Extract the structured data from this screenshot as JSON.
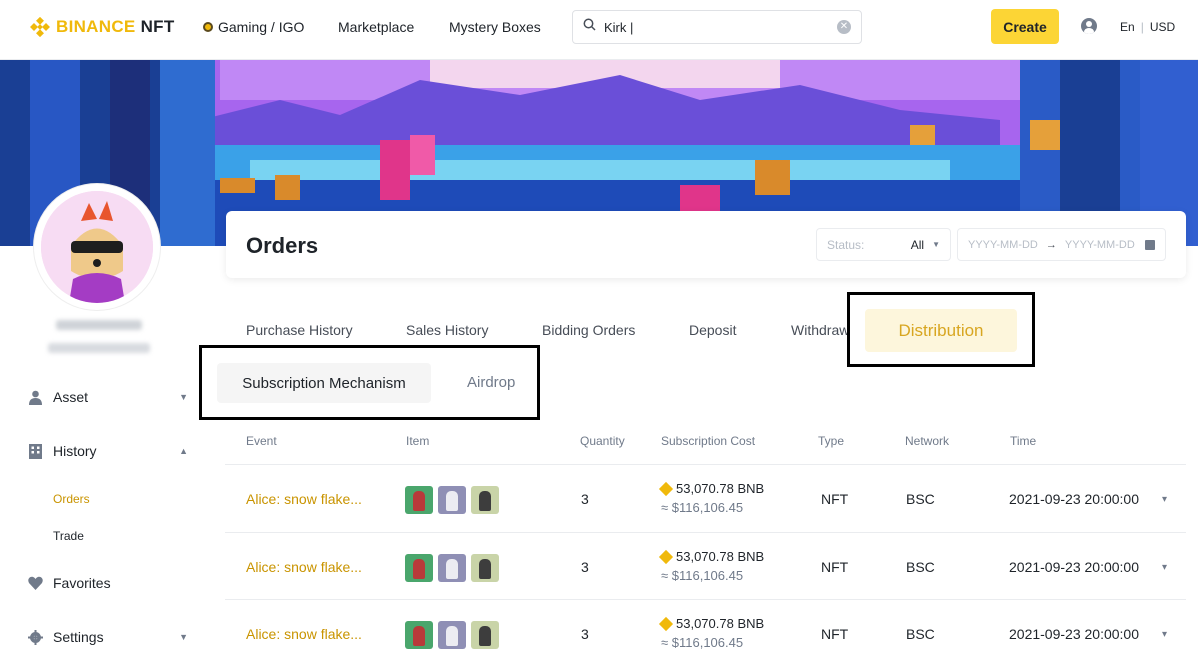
{
  "nav": {
    "logo_brand": "BINANCE",
    "logo_suffix": "NFT",
    "items": [
      {
        "label": "Gaming / IGO"
      },
      {
        "label": "Marketplace"
      },
      {
        "label": "Mystery Boxes"
      }
    ],
    "search_value": "Kirk |",
    "create_label": "Create",
    "lang": "En",
    "currency": "USD"
  },
  "sidebar": {
    "items": [
      {
        "label": "Asset"
      },
      {
        "label": "History"
      },
      {
        "label": "Favorites"
      },
      {
        "label": "Settings"
      }
    ],
    "history_sub": [
      {
        "label": "Orders"
      },
      {
        "label": "Trade"
      }
    ]
  },
  "orders": {
    "title": "Orders",
    "status_label": "Status:",
    "status_value": "All",
    "date_start_placeholder": "YYYY-MM-DD",
    "date_end_placeholder": "YYYY-MM-DD"
  },
  "tabs": [
    {
      "label": "Purchase History"
    },
    {
      "label": "Sales History"
    },
    {
      "label": "Bidding Orders"
    },
    {
      "label": "Deposit"
    },
    {
      "label": "Withdraw"
    },
    {
      "label": "Distribution"
    }
  ],
  "sub_tabs": [
    {
      "label": "Subscription Mechanism"
    },
    {
      "label": "Airdrop"
    }
  ],
  "table": {
    "headers": [
      "Event",
      "Item",
      "Quantity",
      "Subscription Cost",
      "Type",
      "Network",
      "Time"
    ],
    "rows": [
      {
        "event": "Alice: snow flake...",
        "quantity": "3",
        "cost_bnb": "53,070.78 BNB",
        "cost_usd": "≈ $116,106.45",
        "type": "NFT",
        "network": "BSC",
        "time": "2021-09-23 20:00:00"
      },
      {
        "event": "Alice: snow flake...",
        "quantity": "3",
        "cost_bnb": "53,070.78 BNB",
        "cost_usd": "≈ $116,106.45",
        "type": "NFT",
        "network": "BSC",
        "time": "2021-09-23 20:00:00"
      },
      {
        "event": "Alice: snow flake...",
        "quantity": "3",
        "cost_bnb": "53,070.78 BNB",
        "cost_usd": "≈ $116,106.45",
        "type": "NFT",
        "network": "BSC",
        "time": "2021-09-23 20:00:00"
      }
    ]
  },
  "colors": {
    "brand": "#f0b90b",
    "accent_text": "#c99400",
    "create_bg": "#fcd535"
  }
}
